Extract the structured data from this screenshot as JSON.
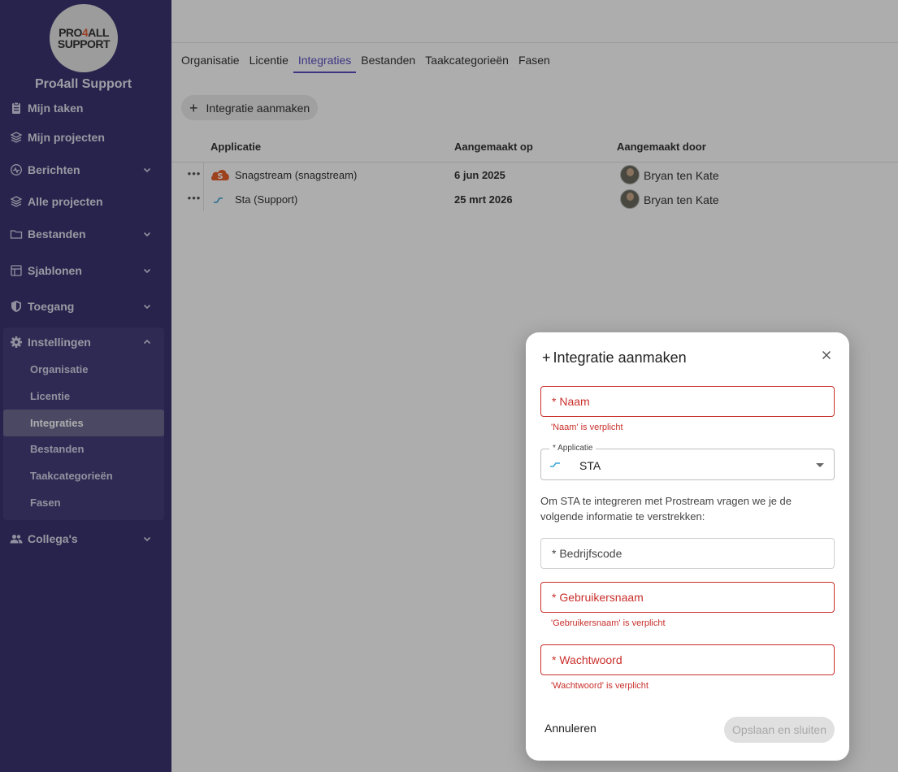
{
  "sidebar": {
    "logo": {
      "line1_a": "PRO",
      "line1_b": "4",
      "line1_c": "ALL",
      "line2": "SUPPORT"
    },
    "org_name": "Pro4all Support",
    "items": [
      {
        "label": "Mijn taken",
        "icon": "clipboard-icon"
      },
      {
        "label": "Mijn projecten",
        "icon": "layers-icon"
      },
      {
        "label": "Berichten",
        "icon": "message-icon"
      },
      {
        "label": "Alle projecten",
        "icon": "stack-icon"
      },
      {
        "label": "Bestanden",
        "icon": "folder-icon"
      },
      {
        "label": "Sjablonen",
        "icon": "template-icon"
      },
      {
        "label": "Toegang",
        "icon": "shield-icon"
      },
      {
        "label": "Instellingen",
        "icon": "gear-icon"
      },
      {
        "label": "Collega's",
        "icon": "people-icon"
      }
    ],
    "settings_sub": [
      "Organisatie",
      "Licentie",
      "Integraties",
      "Bestanden",
      "Taakcategorieën",
      "Fasen"
    ]
  },
  "tabs": [
    "Organisatie",
    "Licentie",
    "Integraties",
    "Bestanden",
    "Taakcategorieën",
    "Fasen"
  ],
  "create_button": "Integratie aanmaken",
  "table": {
    "headers": [
      "Applicatie",
      "Aangemaakt op",
      "Aangemaakt door"
    ],
    "rows": [
      {
        "menu": "•••",
        "app": "Snagstream (snagstream)",
        "date": "6 jun 2025",
        "user": "Bryan ten Kate"
      },
      {
        "menu": "•••",
        "app": "Sta (Support)",
        "date": "25 mrt 2026",
        "user": "Bryan ten Kate"
      }
    ]
  },
  "dialog": {
    "title": "Integratie aanmaken",
    "fields": {
      "naam": {
        "label": "* Naam",
        "error": "'Naam' is verplicht"
      },
      "applicatie": {
        "legend": "* Applicatie",
        "value": "STA"
      },
      "info": "Om STA te integreren met Prostream vragen we je de volgende informatie te verstrekken:",
      "bedrijfscode": {
        "label": "* Bedrijfscode"
      },
      "gebruikersnaam": {
        "label": "* Gebruikersnaam",
        "error": "'Gebruikersnaam' is verplicht"
      },
      "wachtwoord": {
        "label": "* Wachtwoord",
        "error": "'Wachtwoord' is verplicht"
      }
    },
    "cancel": "Annuleren",
    "save": "Opslaan en sluiten"
  },
  "colors": {
    "sidebar_bg": "#3a3470",
    "accent": "#5a4fc2",
    "error": "#c9302c",
    "snagstream_orange": "#e8622c",
    "sta_blue": "#3aa6d8"
  }
}
